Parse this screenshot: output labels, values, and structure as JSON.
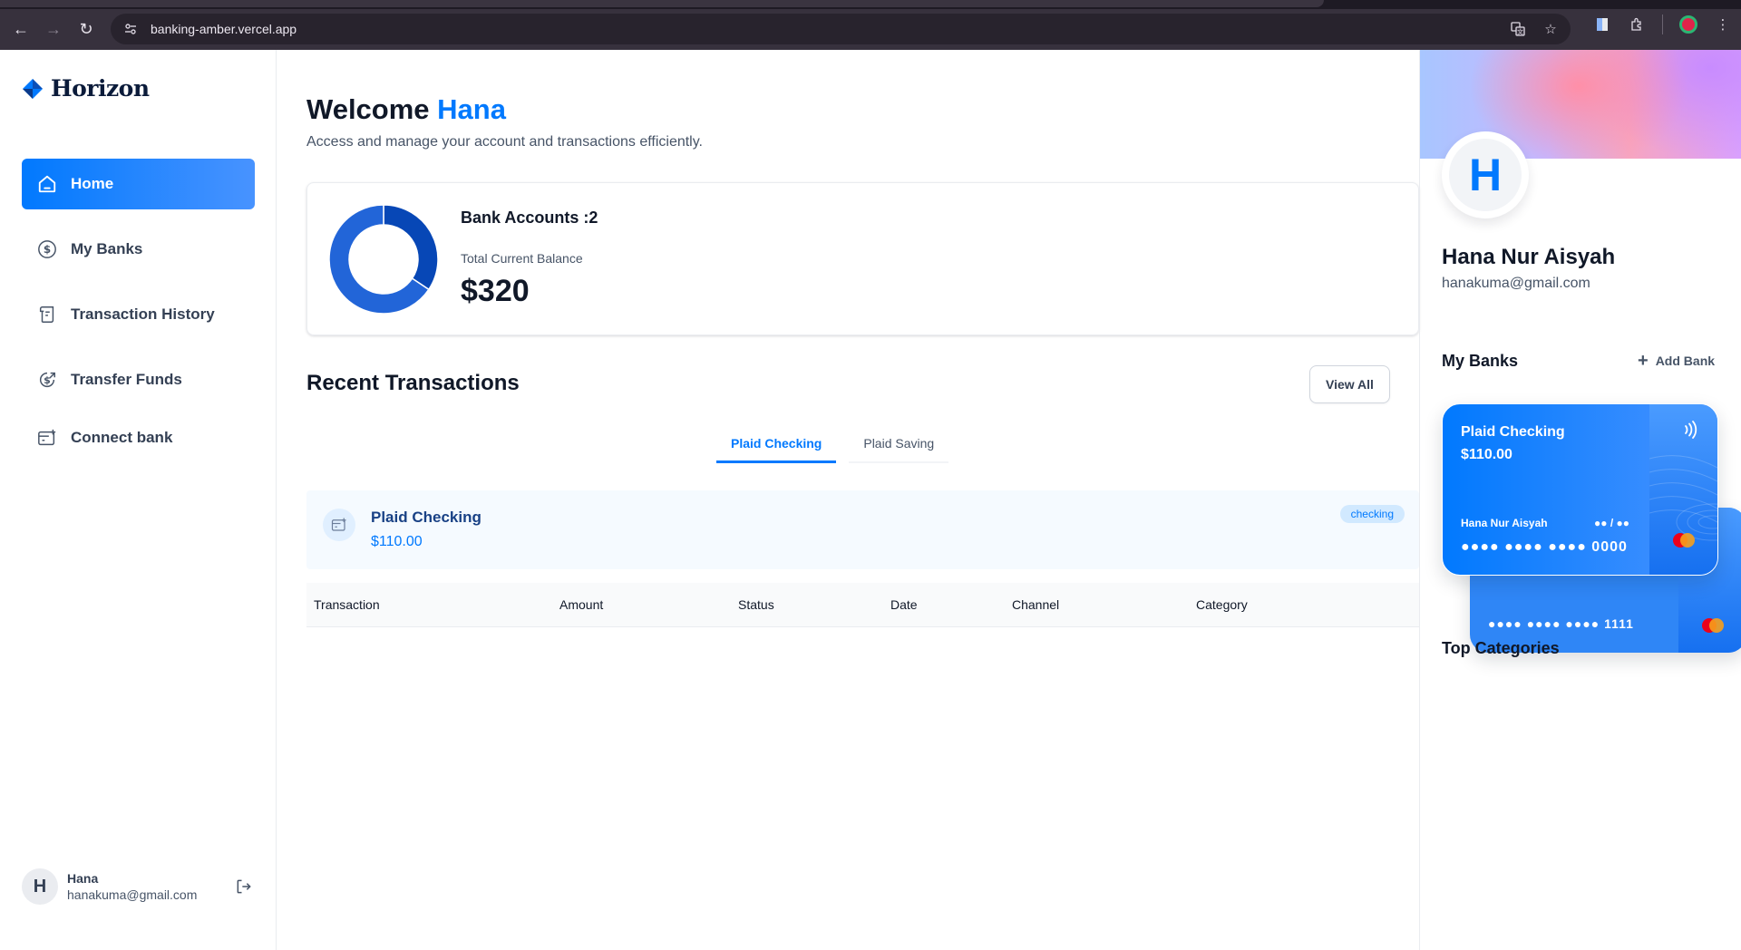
{
  "browser": {
    "url": "banking-amber.vercel.app"
  },
  "app": {
    "logo_text": "Horizon"
  },
  "sidebar": {
    "items": [
      {
        "label": "Home",
        "icon": "home-icon",
        "active": true
      },
      {
        "label": "My Banks",
        "icon": "dollar-circle-icon",
        "active": false
      },
      {
        "label": "Transaction History",
        "icon": "receipt-icon",
        "active": false
      },
      {
        "label": "Transfer Funds",
        "icon": "money-send-icon",
        "active": false
      },
      {
        "label": "Connect bank",
        "icon": "card-add-icon",
        "active": false
      }
    ],
    "user": {
      "initial": "H",
      "name": "Hana",
      "email": "hanakuma@gmail.com"
    }
  },
  "header": {
    "welcome": "Welcome",
    "name": "Hana",
    "subtitle": "Access and manage your account and transactions efficiently."
  },
  "balance": {
    "accounts_label": "Bank Accounts :2",
    "total_label": "Total Current Balance",
    "total_value": "$320",
    "donut": {
      "segments": [
        {
          "value": 110,
          "color": "#0747b6"
        },
        {
          "value": 210,
          "color": "#2265d8"
        }
      ]
    }
  },
  "recent": {
    "title": "Recent Transactions",
    "view_all": "View All",
    "tabs": [
      {
        "label": "Plaid Checking",
        "active": true
      },
      {
        "label": "Plaid Saving",
        "active": false
      }
    ],
    "bank_info": {
      "name": "Plaid Checking",
      "balance": "$110.00",
      "badge": "checking"
    },
    "columns": [
      "Transaction",
      "Amount",
      "Status",
      "Date",
      "Channel",
      "Category"
    ]
  },
  "profile": {
    "initial": "H",
    "name": "Hana Nur Aisyah",
    "email": "hanakuma@gmail.com"
  },
  "my_banks": {
    "title": "My Banks",
    "add_bank": "Add Bank",
    "cards": [
      {
        "name": "Plaid Checking",
        "balance": "$110.00",
        "holder": "Hana Nur Aisyah",
        "expiry": "●● / ●●",
        "number": "●●●● ●●●● ●●●● 0000"
      },
      {
        "number": "●●●● ●●●● ●●●● 1111"
      }
    ]
  },
  "top_categories": {
    "title": "Top Categories"
  },
  "colors": {
    "accent": "#0179fe",
    "text": "#101828",
    "muted": "#475467"
  }
}
